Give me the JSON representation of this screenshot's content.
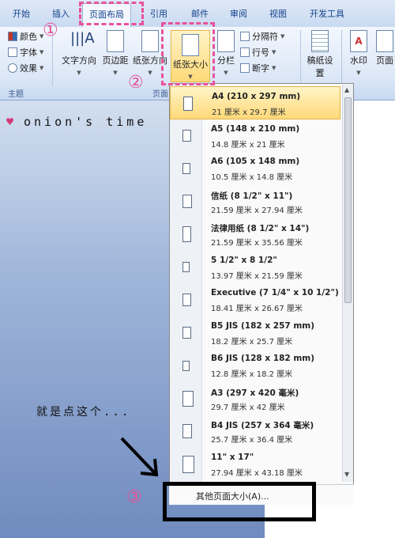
{
  "tabs": [
    "开始",
    "插入",
    "页面布局",
    "引用",
    "邮件",
    "审阅",
    "视图",
    "开发工具"
  ],
  "theme_group": {
    "colors": "颜色",
    "fonts": "字体",
    "effects": "效果",
    "label": "主题"
  },
  "page_setup": {
    "orientation": "文字方向",
    "margins": "页边距",
    "orientation2": "纸张方向",
    "size": "纸张大小",
    "columns": "分栏",
    "breaks": "分隔符",
    "line_numbers": "行号",
    "hyphenation": "断字",
    "group_label": "页面"
  },
  "other_buttons": {
    "manuscript": "稿纸设置",
    "watermark": "水印",
    "page_color": "页面"
  },
  "annotations": {
    "one": "①",
    "two": "②",
    "three": "③",
    "hint": "就是点这个...",
    "heart": "♥",
    "brand": "onion's time"
  },
  "paper_sizes": [
    {
      "name": "A4 (210 x 297 mm)",
      "dim": "21 厘米 x 29.7 厘米",
      "selected": true
    },
    {
      "name": "A5 (148 x 210 mm)",
      "dim": "14.8 厘米 x 21 厘米",
      "selected": false
    },
    {
      "name": "A6 (105 x 148 mm)",
      "dim": "10.5 厘米 x 14.8 厘米",
      "selected": false
    },
    {
      "name": "信纸 (8 1/2\" x 11\")",
      "dim": "21.59 厘米 x 27.94 厘米",
      "selected": false
    },
    {
      "name": "法律用纸 (8 1/2\" x 14\")",
      "dim": "21.59 厘米 x 35.56 厘米",
      "selected": false
    },
    {
      "name": "5 1/2\" x 8 1/2\"",
      "dim": "13.97 厘米 x 21.59 厘米",
      "selected": false
    },
    {
      "name": "Executive (7 1/4\" x 10 1/2\")",
      "dim": "18.41 厘米 x 26.67 厘米",
      "selected": false
    },
    {
      "name": "B5 JIS (182 x 257 mm)",
      "dim": "18.2 厘米 x 25.7 厘米",
      "selected": false
    },
    {
      "name": "B6 JIS (128 x 182 mm)",
      "dim": "12.8 厘米 x 18.2 厘米",
      "selected": false
    },
    {
      "name": "A3 (297 x 420 毫米)",
      "dim": "29.7 厘米 x 42 厘米",
      "selected": false
    },
    {
      "name": "B4 JIS (257 x 364 毫米)",
      "dim": "25.7 厘米 x 36.4 厘米",
      "selected": false
    },
    {
      "name": "11\" x 17\"",
      "dim": "27.94 厘米 x 43.18 厘米",
      "selected": false
    }
  ],
  "more_sizes": "其他页面大小(A)..."
}
